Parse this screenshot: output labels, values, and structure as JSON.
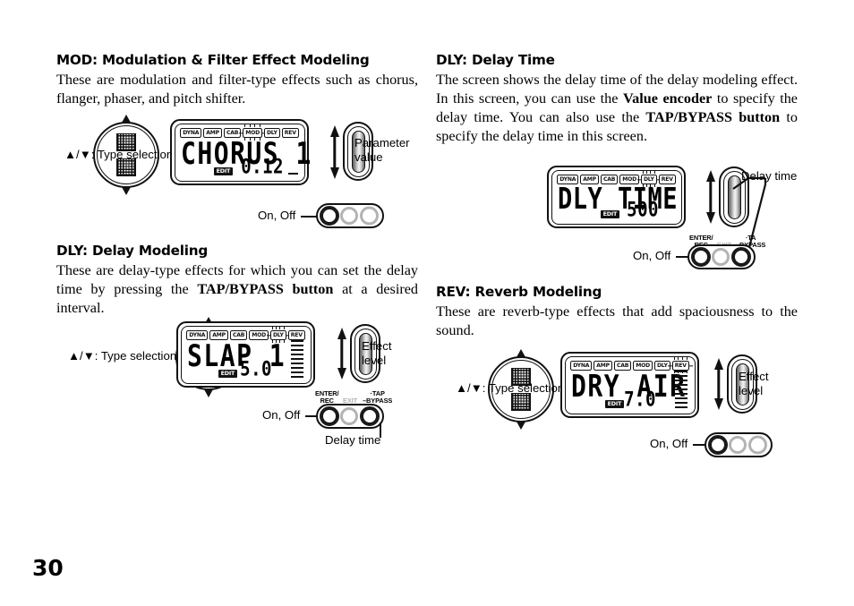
{
  "page": {
    "number": "30"
  },
  "sections": [
    {
      "id": "mod",
      "title": "MOD: Modulation & Filter Effect Modeling",
      "body_html": "These are modulation and filter-type effects such as chorus, flanger, phaser, and pitch shifter."
    },
    {
      "id": "dly-modeling",
      "title": "DLY: Delay Modeling",
      "body_html": "These are delay-type effects for which you can set the delay time by pressing the TAP/BYPASS button at a desired interval."
    },
    {
      "id": "dly-time",
      "title": "DLY: Delay Time",
      "body_html": "The screen shows the delay time of the delay modeling effect. In this screen, you can use the Value encoder to specify the delay time. You can also use the TAP/BYPASS button to specify the delay time in this screen."
    },
    {
      "id": "rev",
      "title": "REV: Reverb Modeling",
      "body_html": "These are reverb-type effects that add spaciousness to the sound."
    }
  ],
  "figures": {
    "mod": {
      "type_selection_label": "▲/▼: Type selection",
      "lcd": {
        "badges": [
          "DYNA",
          "AMP",
          "CAB",
          "MOD",
          "DLY",
          "REV"
        ],
        "active_badge": "MOD",
        "main_text": "CHORUS 1",
        "value": "0.12",
        "edit_tag": "EDIT",
        "bargraph_segments": 0,
        "cursor": true
      },
      "encoder_label_line1": "Parameter",
      "encoder_label_line2": "value",
      "switch_label": "On, Off",
      "switches": [
        "dark",
        "gray",
        "gray"
      ]
    },
    "dly_modeling": {
      "type_selection_label": "▲/▼: Type selection",
      "lcd": {
        "badges": [
          "DYNA",
          "AMP",
          "CAB",
          "MOD",
          "DLY",
          "REV"
        ],
        "active_badge": "DLY",
        "main_text": "SLAP 1",
        "value": "5.0",
        "edit_tag": "EDIT",
        "bargraph_segments": 9,
        "cursor": false
      },
      "encoder_label_line1": "Effect",
      "encoder_label_line2": "level",
      "switch_label": "On, Off",
      "switch_captions": {
        "enter_rec_line1": "ENTER/",
        "enter_rec_line2": "REC",
        "exit": "EXIT",
        "tap_line1": "·TAP",
        "tap_line2": "–BYPASS"
      },
      "delay_time_label": "Delay time",
      "switches": [
        "dark",
        "gray",
        "dark"
      ]
    },
    "dly_time": {
      "lcd": {
        "badges": [
          "DYNA",
          "AMP",
          "CAB",
          "MOD",
          "DLY",
          "REV"
        ],
        "active_badge": "DLY",
        "main_text": "DLY TIME",
        "value": "500",
        "edit_tag": "EDIT",
        "bargraph_segments": 0,
        "cursor": false
      },
      "delay_time_label": "Delay time",
      "switch_label": "On, Off",
      "switch_captions": {
        "enter_rec_line1": "ENTER/",
        "enter_rec_line2": "REC",
        "exit": "EXIT",
        "tap_line1": "·TA",
        "tap_line2": "–BYPASS"
      },
      "switches": [
        "dark",
        "gray",
        "dark"
      ]
    },
    "rev": {
      "type_selection_label": "▲/▼: Type selection",
      "lcd": {
        "badges": [
          "DYNA",
          "AMP",
          "CAB",
          "MOD",
          "DLY",
          "REV"
        ],
        "active_badge": "REV",
        "main_text": "DRY AIR",
        "value": "7.0",
        "edit_tag": "EDIT",
        "bargraph_segments": 9,
        "cursor": false
      },
      "encoder_label_line1": "Effect",
      "encoder_label_line2": "level",
      "switch_label": "On, Off",
      "switches": [
        "dark",
        "gray",
        "gray"
      ]
    }
  },
  "colors": {
    "ink": "#111111",
    "gray_switch": "#b3b3b3",
    "paper": "#ffffff"
  }
}
